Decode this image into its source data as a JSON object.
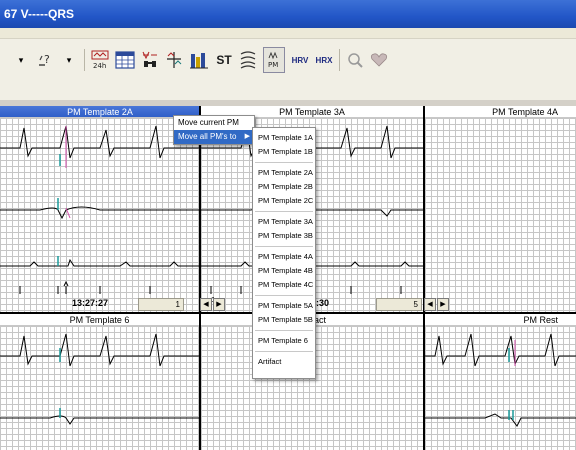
{
  "window": {
    "title": "67 V-----QRS"
  },
  "toolbar": {
    "items": [
      {
        "name": "dropdown-arrow-icon",
        "label": "▾"
      },
      {
        "name": "magnify-help-icon",
        "label": "..?"
      },
      {
        "name": "dropdown-arrow-icon-2",
        "label": "▾"
      },
      {
        "name": "24h-icon",
        "label": "24h"
      },
      {
        "name": "calendar-grid-icon",
        "label": ""
      },
      {
        "name": "binoculars-icon",
        "label": ""
      },
      {
        "name": "split-view-icon",
        "label": ""
      },
      {
        "name": "bar-chart-icon",
        "label": ""
      },
      {
        "name": "st-button",
        "label": "ST"
      },
      {
        "name": "multi-trace-icon",
        "label": ""
      },
      {
        "name": "pm-button",
        "label": "PM"
      },
      {
        "name": "hrv-button",
        "label": "HRV"
      },
      {
        "name": "hrx-button",
        "label": "HRX"
      },
      {
        "name": "zoom-icon",
        "label": ""
      },
      {
        "name": "heart-icon",
        "label": ""
      }
    ]
  },
  "panels": {
    "pm2a": {
      "title": "PM Template 2A"
    },
    "pm3a": {
      "title": "PM Template 3A"
    },
    "pm4a": {
      "title": "PM Template 4A"
    },
    "pm6": {
      "title": "PM Template 6"
    },
    "artifact": {
      "title": "Artifact"
    },
    "pmrest": {
      "title": "PM Rest"
    }
  },
  "status": {
    "time_left": "13:27:27",
    "time_right_fragment": ":30",
    "page_left": "1",
    "page_right": "5",
    "nav_prev": "◀",
    "nav_next": "▶",
    "beat_marker_label": "1"
  },
  "context_menu": {
    "items": [
      {
        "label": "Move current PM to..."
      },
      {
        "label": "Move all PM's to",
        "highlighted": true
      }
    ],
    "submenu": [
      "PM Template 1A",
      "PM Template 1B",
      "|",
      "PM Template 2A",
      "PM Template 2B",
      "PM Template 2C",
      "|",
      "PM Template 3A",
      "PM Template 3B",
      "|",
      "PM Template 4A",
      "PM Template 4B",
      "PM Template 4C",
      "|",
      "PM Template 5A",
      "PM Template 5B",
      "|",
      "PM Template 6",
      "|",
      "Artifact"
    ]
  },
  "colors": {
    "titlebar": "#2256c7",
    "selection": "#316ac5",
    "trace": "#000000",
    "pace_marker_teal": "#1a9a9a",
    "pace_marker_pink": "#d04aa8"
  }
}
